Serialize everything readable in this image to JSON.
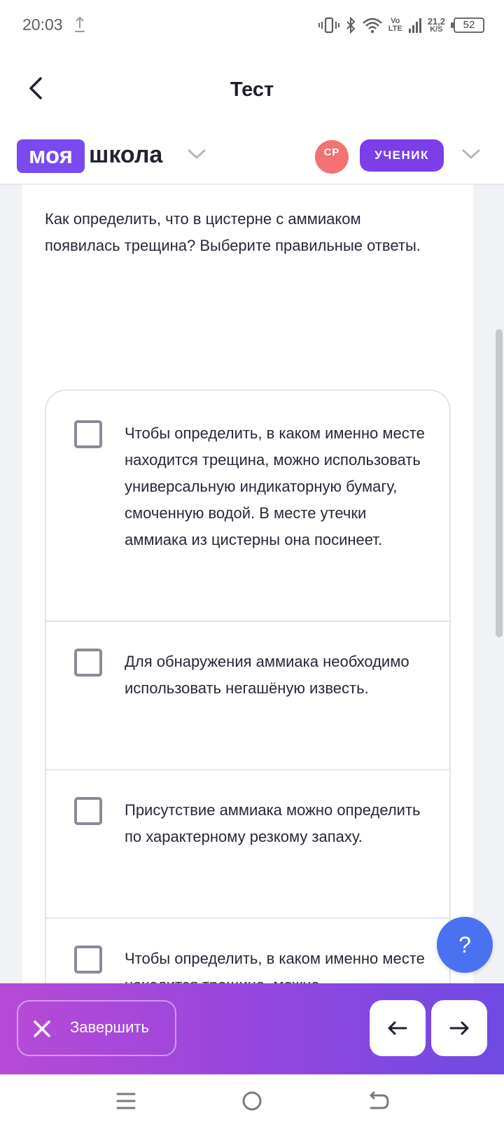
{
  "status_bar": {
    "time": "20:03",
    "network_vo": "Vo",
    "network_lte": "LTE",
    "speed_value": "21,2",
    "speed_unit": "K/S",
    "battery": "52"
  },
  "header": {
    "title": "Тест"
  },
  "brand": {
    "logo_part1": "моя",
    "logo_part2": "школа",
    "avatar_initials": "СР",
    "role": "УЧЕНИК"
  },
  "question": {
    "text": "Как определить, что в цистерне с аммиаком появилась трещина? Выберите правильные ответы."
  },
  "options": [
    {
      "text": "Чтобы определить, в каком именно месте находится трещина, можно использовать универсальную индикаторную бумагу, смоченную водой. В месте утечки аммиака из цистерны она посинеет.",
      "checked": false
    },
    {
      "text": "Для обнаружения аммиака необходимо использовать негашёную известь.",
      "checked": false
    },
    {
      "text": "Присутствие аммиака можно определить по характерному резкому запаху.",
      "checked": false
    },
    {
      "text": "Чтобы определить, в каком именно месте находится трещина, можно",
      "checked": false
    }
  ],
  "help_button": "?",
  "bottom_bar": {
    "finish_label": "Завершить"
  },
  "colors": {
    "brand_purple": "#7a49f0",
    "avatar_red": "#f37272",
    "help_blue": "#4a72f0",
    "bar_gradient_start": "#b74ad6",
    "bar_gradient_end": "#6f4ae3"
  }
}
